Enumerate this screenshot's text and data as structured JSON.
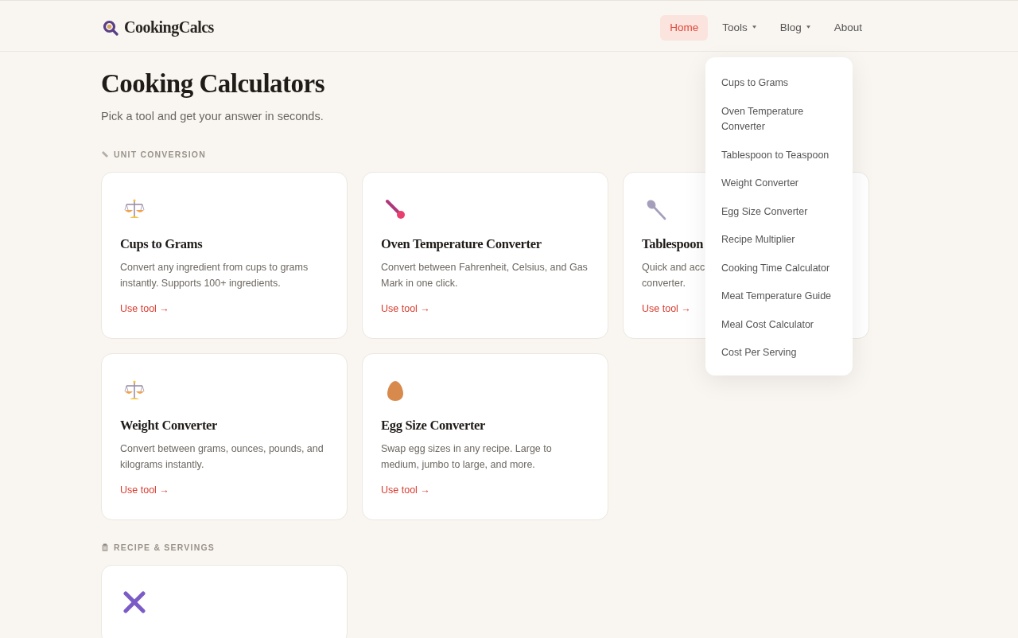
{
  "brand": {
    "name": "CookingCalcs"
  },
  "nav": [
    {
      "label": "Home",
      "selected": true,
      "dropdown": false
    },
    {
      "label": "Tools",
      "selected": false,
      "dropdown": true
    },
    {
      "label": "Blog",
      "selected": false,
      "dropdown": true
    },
    {
      "label": "About",
      "selected": false,
      "dropdown": false
    }
  ],
  "page": {
    "title": "Cooking Calculators",
    "subtitle": "Pick a tool and get your answer in seconds."
  },
  "sections": [
    {
      "heading": "UNIT CONVERSION",
      "cards": [
        {
          "title": "Cups to Grams",
          "description": [
            "Convert any ingredient from cups to grams",
            "instantly. Supports 100+ ingredients."
          ],
          "link": "Use tool →"
        },
        {
          "title": "Oven Temperature Converter",
          "description": [
            "Convert between Fahrenheit, Celsius, and Gas",
            "Mark in one click."
          ],
          "link": "Use tool →"
        },
        {
          "title": "Tablespoon",
          "description": [
            "Quick and acc",
            "converter."
          ],
          "link": "Use tool →"
        },
        {
          "title": "Weight Converter",
          "description": [
            "Convert between grams, ounces, pounds, and",
            "kilograms instantly."
          ],
          "link": "Use tool →"
        },
        {
          "title": "Egg Size Converter",
          "description": [
            "Swap egg sizes in any recipe. Large to",
            "medium, jumbo to large, and more."
          ],
          "link": "Use tool →"
        }
      ]
    },
    {
      "heading": "RECIPE & SERVINGS",
      "cards": [
        {
          "kind": "icon-only"
        }
      ]
    }
  ],
  "menu": {
    "items": [
      "Cups to Grams",
      "Oven Temperature Converter",
      "Tablespoon to Teaspoon",
      "Weight Converter",
      "Egg Size Converter",
      "Recipe Multiplier",
      "Cooking Time Calculator",
      "Meat Temperature Guide",
      "Meal Cost Calculator",
      "Cost Per Serving"
    ]
  }
}
